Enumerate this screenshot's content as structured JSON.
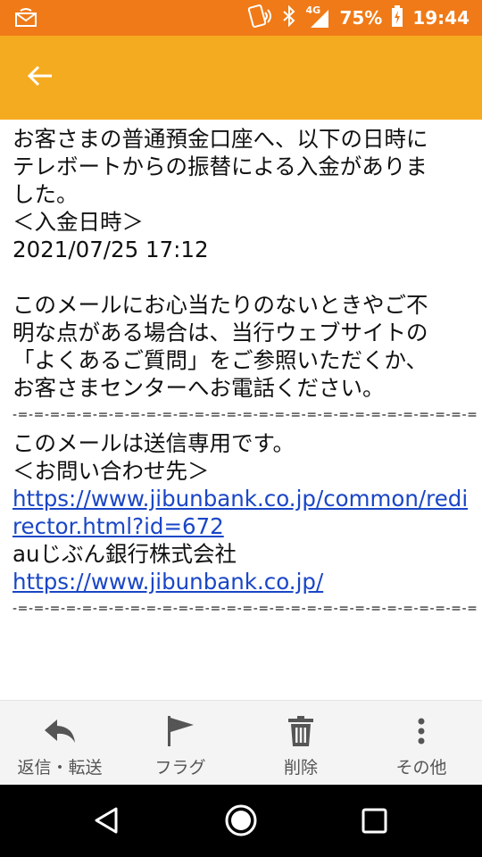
{
  "status_bar": {
    "network": "4G",
    "battery": "75%",
    "time": "19:44"
  },
  "app_bar": {
    "back_icon": "arrow-back-icon"
  },
  "message": {
    "lines": [
      "お客さまの普通預金口座へ、以下の日時に",
      "テレボートからの振替による入金がありま",
      "した。",
      "＜入金日時＞",
      "2021/07/25 17:12",
      "",
      "このメールにお心当たりのないときやご不",
      "明な点がある場合は、当行ウェブサイトの",
      "「よくあるご質問」をご参照いただくか、",
      "お客さまセンターへお電話ください。",
      "-=-=-=-=-=-=-=-=-=-=-=-=-=-=-=-=-=-=-=-=-=-=-=-=-=-=-=-=-=",
      "このメールは送信専用です。",
      "＜お問い合わせ先＞"
    ],
    "link1_line1": "https://www.jibunbank.co.jp/common/redi",
    "link1_line2": "rector.html?id=672",
    "company": "auじぶん銀行株式会社",
    "link2": "https://www.jibunbank.co.jp/",
    "separator_end": "-=-=-=-=-=-=-=-=-=-=-=-=-=-=-=-=-=-=-=-=-=-=-=-=-=-=-=-=-="
  },
  "toolbar": {
    "reply_label": "返信・転送",
    "flag_label": "フラグ",
    "delete_label": "削除",
    "more_label": "その他"
  },
  "colors": {
    "status_bar": "#f07a17",
    "app_bar": "#f5ab1f",
    "link": "#1a46c6"
  }
}
